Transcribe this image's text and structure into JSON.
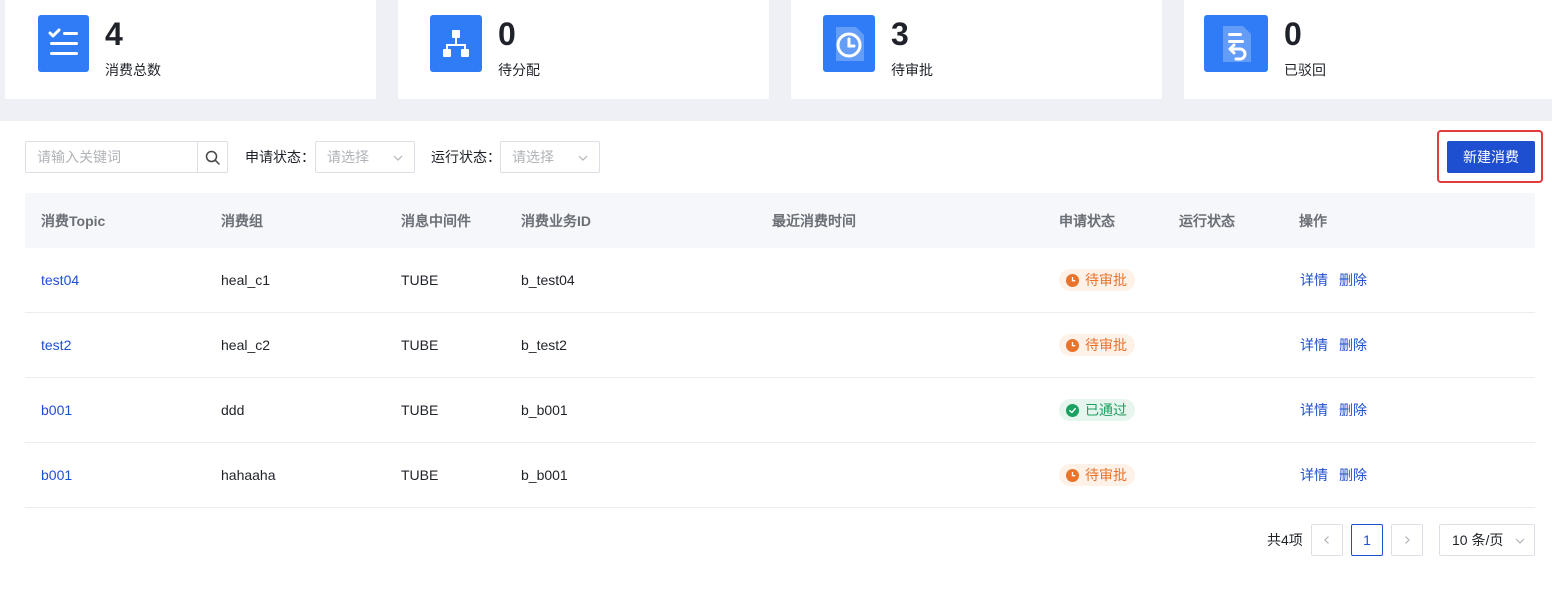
{
  "stats": [
    {
      "value": "4",
      "label": "消费总数",
      "icon": "checklist-icon"
    },
    {
      "value": "0",
      "label": "待分配",
      "icon": "hierarchy-icon"
    },
    {
      "value": "3",
      "label": "待审批",
      "icon": "clock-document-icon"
    },
    {
      "value": "0",
      "label": "已驳回",
      "icon": "return-document-icon"
    }
  ],
  "filters": {
    "search_placeholder": "请输入关键词",
    "apply_status_label": "申请状态：",
    "apply_status_placeholder": "请选择",
    "run_status_label": "运行状态：",
    "run_status_placeholder": "请选择"
  },
  "new_button_label": "新建消费",
  "table": {
    "columns": [
      "消费Topic",
      "消费组",
      "消息中间件",
      "消费业务ID",
      "最近消费时间",
      "申请状态",
      "运行状态",
      "操作"
    ],
    "rows": [
      {
        "topic": "test04",
        "group": "heal_c1",
        "middleware": "TUBE",
        "business_id": "b_test04",
        "last_time": "",
        "apply_status": "待审批",
        "status_kind": "pending",
        "run_status": "",
        "detail": "详情",
        "delete": "删除"
      },
      {
        "topic": "test2",
        "group": "heal_c2",
        "middleware": "TUBE",
        "business_id": "b_test2",
        "last_time": "",
        "apply_status": "待审批",
        "status_kind": "pending",
        "run_status": "",
        "detail": "详情",
        "delete": "删除"
      },
      {
        "topic": "b001",
        "group": "ddd",
        "middleware": "TUBE",
        "business_id": "b_b001",
        "last_time": "",
        "apply_status": "已通过",
        "status_kind": "passed",
        "run_status": "",
        "detail": "详情",
        "delete": "删除"
      },
      {
        "topic": "b001",
        "group": "hahaaha",
        "middleware": "TUBE",
        "business_id": "b_b001",
        "last_time": "",
        "apply_status": "待审批",
        "status_kind": "pending",
        "run_status": "",
        "detail": "详情",
        "delete": "删除"
      }
    ]
  },
  "pagination": {
    "total": "共4项",
    "current_page": "1",
    "page_size": "10 条/页"
  },
  "colors": {
    "primary": "#1f4fd1",
    "icon_bg": "#2f7cf6",
    "pending": "#e8742c",
    "passed": "#19a15f",
    "highlight": "#e23b3b"
  }
}
